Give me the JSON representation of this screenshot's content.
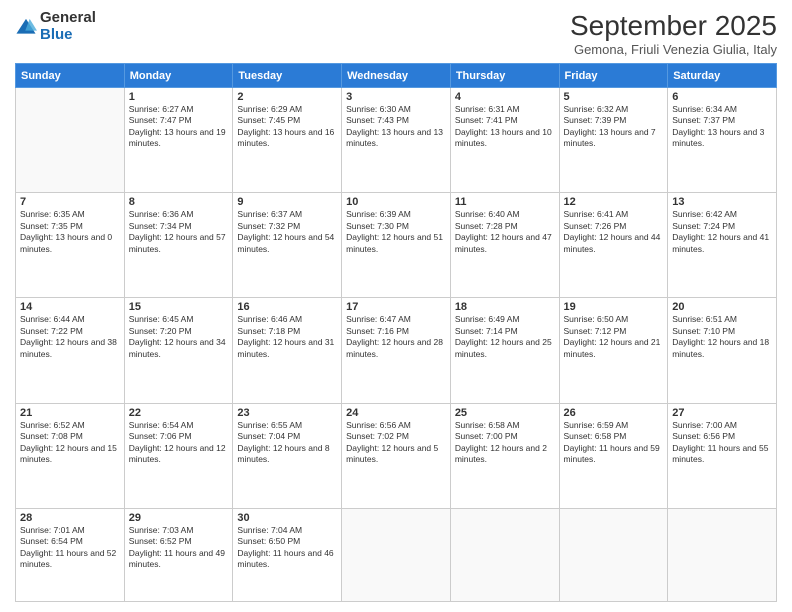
{
  "logo": {
    "general": "General",
    "blue": "Blue"
  },
  "header": {
    "month": "September 2025",
    "subtitle": "Gemona, Friuli Venezia Giulia, Italy"
  },
  "weekdays": [
    "Sunday",
    "Monday",
    "Tuesday",
    "Wednesday",
    "Thursday",
    "Friday",
    "Saturday"
  ],
  "weeks": [
    [
      {
        "day": "",
        "sunrise": "",
        "sunset": "",
        "daylight": ""
      },
      {
        "day": "1",
        "sunrise": "Sunrise: 6:27 AM",
        "sunset": "Sunset: 7:47 PM",
        "daylight": "Daylight: 13 hours and 19 minutes."
      },
      {
        "day": "2",
        "sunrise": "Sunrise: 6:29 AM",
        "sunset": "Sunset: 7:45 PM",
        "daylight": "Daylight: 13 hours and 16 minutes."
      },
      {
        "day": "3",
        "sunrise": "Sunrise: 6:30 AM",
        "sunset": "Sunset: 7:43 PM",
        "daylight": "Daylight: 13 hours and 13 minutes."
      },
      {
        "day": "4",
        "sunrise": "Sunrise: 6:31 AM",
        "sunset": "Sunset: 7:41 PM",
        "daylight": "Daylight: 13 hours and 10 minutes."
      },
      {
        "day": "5",
        "sunrise": "Sunrise: 6:32 AM",
        "sunset": "Sunset: 7:39 PM",
        "daylight": "Daylight: 13 hours and 7 minutes."
      },
      {
        "day": "6",
        "sunrise": "Sunrise: 6:34 AM",
        "sunset": "Sunset: 7:37 PM",
        "daylight": "Daylight: 13 hours and 3 minutes."
      }
    ],
    [
      {
        "day": "7",
        "sunrise": "Sunrise: 6:35 AM",
        "sunset": "Sunset: 7:35 PM",
        "daylight": "Daylight: 13 hours and 0 minutes."
      },
      {
        "day": "8",
        "sunrise": "Sunrise: 6:36 AM",
        "sunset": "Sunset: 7:34 PM",
        "daylight": "Daylight: 12 hours and 57 minutes."
      },
      {
        "day": "9",
        "sunrise": "Sunrise: 6:37 AM",
        "sunset": "Sunset: 7:32 PM",
        "daylight": "Daylight: 12 hours and 54 minutes."
      },
      {
        "day": "10",
        "sunrise": "Sunrise: 6:39 AM",
        "sunset": "Sunset: 7:30 PM",
        "daylight": "Daylight: 12 hours and 51 minutes."
      },
      {
        "day": "11",
        "sunrise": "Sunrise: 6:40 AM",
        "sunset": "Sunset: 7:28 PM",
        "daylight": "Daylight: 12 hours and 47 minutes."
      },
      {
        "day": "12",
        "sunrise": "Sunrise: 6:41 AM",
        "sunset": "Sunset: 7:26 PM",
        "daylight": "Daylight: 12 hours and 44 minutes."
      },
      {
        "day": "13",
        "sunrise": "Sunrise: 6:42 AM",
        "sunset": "Sunset: 7:24 PM",
        "daylight": "Daylight: 12 hours and 41 minutes."
      }
    ],
    [
      {
        "day": "14",
        "sunrise": "Sunrise: 6:44 AM",
        "sunset": "Sunset: 7:22 PM",
        "daylight": "Daylight: 12 hours and 38 minutes."
      },
      {
        "day": "15",
        "sunrise": "Sunrise: 6:45 AM",
        "sunset": "Sunset: 7:20 PM",
        "daylight": "Daylight: 12 hours and 34 minutes."
      },
      {
        "day": "16",
        "sunrise": "Sunrise: 6:46 AM",
        "sunset": "Sunset: 7:18 PM",
        "daylight": "Daylight: 12 hours and 31 minutes."
      },
      {
        "day": "17",
        "sunrise": "Sunrise: 6:47 AM",
        "sunset": "Sunset: 7:16 PM",
        "daylight": "Daylight: 12 hours and 28 minutes."
      },
      {
        "day": "18",
        "sunrise": "Sunrise: 6:49 AM",
        "sunset": "Sunset: 7:14 PM",
        "daylight": "Daylight: 12 hours and 25 minutes."
      },
      {
        "day": "19",
        "sunrise": "Sunrise: 6:50 AM",
        "sunset": "Sunset: 7:12 PM",
        "daylight": "Daylight: 12 hours and 21 minutes."
      },
      {
        "day": "20",
        "sunrise": "Sunrise: 6:51 AM",
        "sunset": "Sunset: 7:10 PM",
        "daylight": "Daylight: 12 hours and 18 minutes."
      }
    ],
    [
      {
        "day": "21",
        "sunrise": "Sunrise: 6:52 AM",
        "sunset": "Sunset: 7:08 PM",
        "daylight": "Daylight: 12 hours and 15 minutes."
      },
      {
        "day": "22",
        "sunrise": "Sunrise: 6:54 AM",
        "sunset": "Sunset: 7:06 PM",
        "daylight": "Daylight: 12 hours and 12 minutes."
      },
      {
        "day": "23",
        "sunrise": "Sunrise: 6:55 AM",
        "sunset": "Sunset: 7:04 PM",
        "daylight": "Daylight: 12 hours and 8 minutes."
      },
      {
        "day": "24",
        "sunrise": "Sunrise: 6:56 AM",
        "sunset": "Sunset: 7:02 PM",
        "daylight": "Daylight: 12 hours and 5 minutes."
      },
      {
        "day": "25",
        "sunrise": "Sunrise: 6:58 AM",
        "sunset": "Sunset: 7:00 PM",
        "daylight": "Daylight: 12 hours and 2 minutes."
      },
      {
        "day": "26",
        "sunrise": "Sunrise: 6:59 AM",
        "sunset": "Sunset: 6:58 PM",
        "daylight": "Daylight: 11 hours and 59 minutes."
      },
      {
        "day": "27",
        "sunrise": "Sunrise: 7:00 AM",
        "sunset": "Sunset: 6:56 PM",
        "daylight": "Daylight: 11 hours and 55 minutes."
      }
    ],
    [
      {
        "day": "28",
        "sunrise": "Sunrise: 7:01 AM",
        "sunset": "Sunset: 6:54 PM",
        "daylight": "Daylight: 11 hours and 52 minutes."
      },
      {
        "day": "29",
        "sunrise": "Sunrise: 7:03 AM",
        "sunset": "Sunset: 6:52 PM",
        "daylight": "Daylight: 11 hours and 49 minutes."
      },
      {
        "day": "30",
        "sunrise": "Sunrise: 7:04 AM",
        "sunset": "Sunset: 6:50 PM",
        "daylight": "Daylight: 11 hours and 46 minutes."
      },
      {
        "day": "",
        "sunrise": "",
        "sunset": "",
        "daylight": ""
      },
      {
        "day": "",
        "sunrise": "",
        "sunset": "",
        "daylight": ""
      },
      {
        "day": "",
        "sunrise": "",
        "sunset": "",
        "daylight": ""
      },
      {
        "day": "",
        "sunrise": "",
        "sunset": "",
        "daylight": ""
      }
    ]
  ]
}
